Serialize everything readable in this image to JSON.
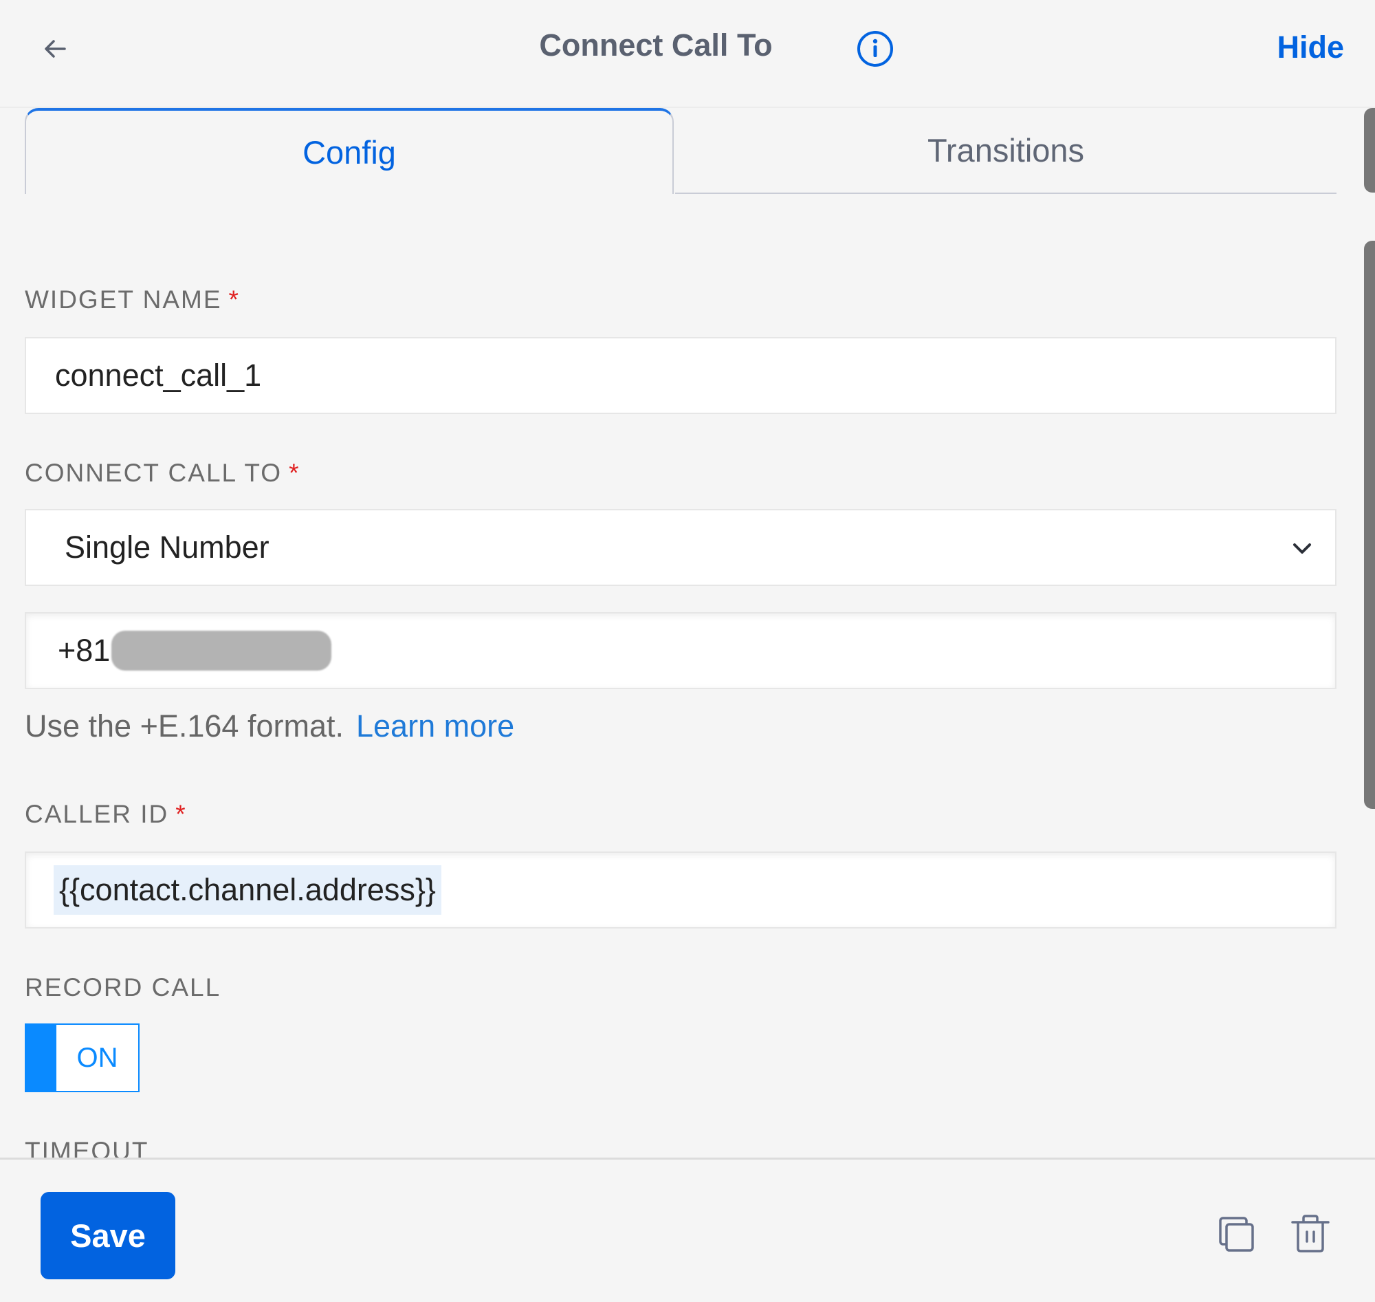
{
  "header": {
    "title": "Connect Call To",
    "hide_label": "Hide",
    "back_icon": "arrow-left-icon",
    "info_icon": "info-circle-icon"
  },
  "tabs": [
    {
      "label": "Config",
      "active": true
    },
    {
      "label": "Transitions",
      "active": false
    }
  ],
  "form": {
    "widget_name": {
      "label": "WIDGET NAME",
      "required_mark": "*",
      "value": "connect_call_1"
    },
    "connect_call_to": {
      "label": "CONNECT CALL TO",
      "required_mark": "*",
      "selected": "Single Number"
    },
    "phone_number": {
      "value_prefix": "+81",
      "redacted": true
    },
    "help_text": "Use the +E.164 format.",
    "learn_more_label": "Learn more",
    "caller_id": {
      "label": "CALLER ID",
      "required_mark": "*",
      "value": "{{contact.channel.address}}"
    },
    "record_call": {
      "label": "RECORD CALL",
      "state_label": "ON",
      "on": true
    },
    "timeout": {
      "label": "TIMEOUT"
    }
  },
  "footer": {
    "save_label": "Save",
    "duplicate_icon": "copy-icon",
    "delete_icon": "trash-icon"
  },
  "colors": {
    "accent": "#0263e0",
    "toggle": "#0a8aff",
    "required": "#e02020"
  }
}
